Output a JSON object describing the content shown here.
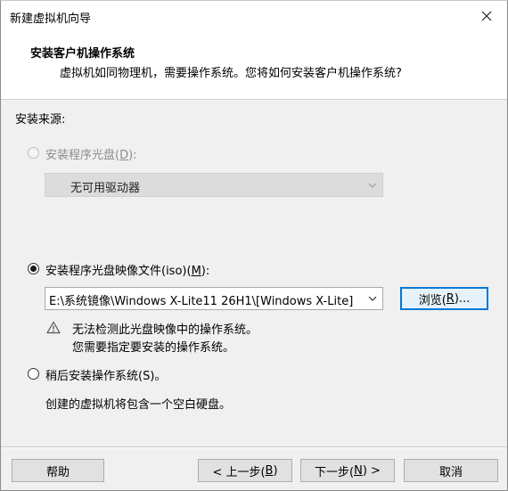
{
  "window": {
    "title": "新建虚拟机向导",
    "close_icon": "close-icon"
  },
  "header": {
    "title": "安装客户机操作系统",
    "description": "虚拟机如同物理机，需要操作系统。您将如何安装客户机操作系统?"
  },
  "install_source": {
    "label": "安装来源:",
    "disc_option": {
      "label_prefix": "安装程序光盘(",
      "label_key": "D",
      "label_suffix": "):",
      "enabled": false,
      "checked": false,
      "drive_value": "无可用驱动器"
    },
    "iso_option": {
      "label_prefix": "安装程序光盘映像文件(iso)(",
      "label_key": "M",
      "label_suffix": "):",
      "enabled": true,
      "checked": true,
      "path_value": "E:\\系统镜像\\Windows X-Lite11 26H1\\[Windows X-Lite]",
      "browse_prefix": "浏览(",
      "browse_key": "R",
      "browse_suffix": ")...",
      "warning_line1": "无法检测此光盘映像中的操作系统。",
      "warning_line2": "您需要指定要安装的操作系统。"
    },
    "later_option": {
      "label": "稍后安装操作系统(S)。",
      "checked": false,
      "description": "创建的虚拟机将包含一个空白硬盘。"
    }
  },
  "footer": {
    "help_label": "帮助",
    "back_prefix": "< 上一步(",
    "back_key": "B",
    "back_suffix": ")",
    "next_prefix": "下一步(",
    "next_key": "N",
    "next_suffix": ") >",
    "cancel_label": "取消"
  }
}
